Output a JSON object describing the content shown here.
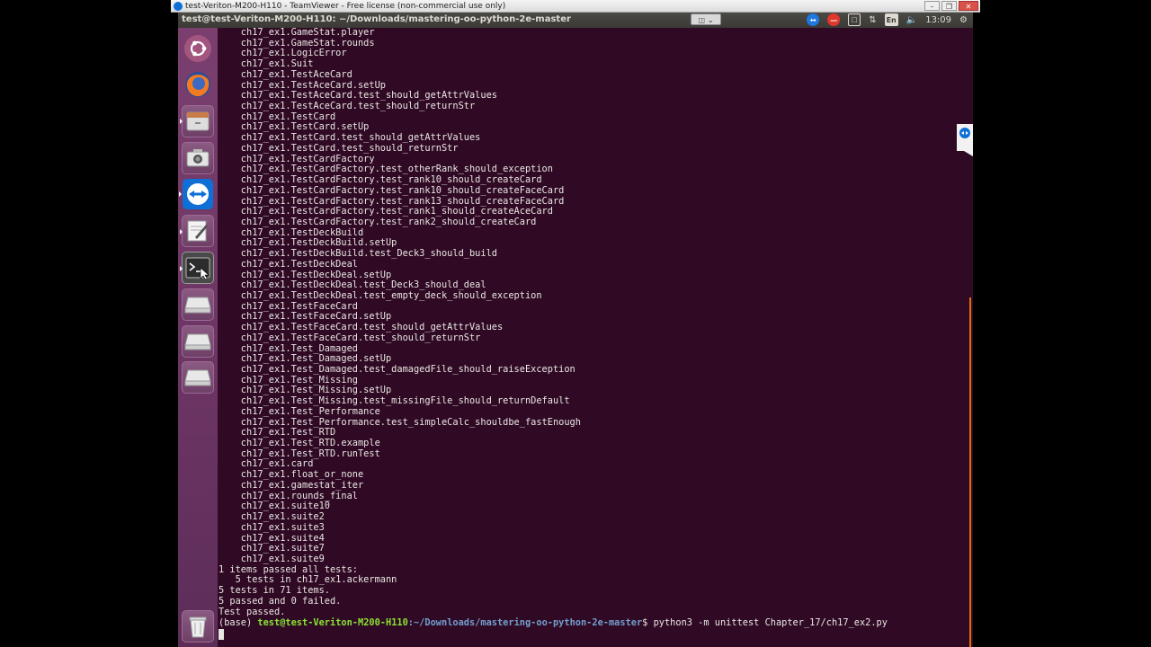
{
  "teamviewer": {
    "title": "test-Veriton-M200-H110 - TeamViewer - Free license (non-commercial use only)",
    "controls": [
      "minimize",
      "restore",
      "close"
    ]
  },
  "panel": {
    "window_title": "test@test-Veriton-M200-H110: ~/Downloads/mastering-oo-python-2e-master",
    "keyboard_layout": "En",
    "clock": "13:09"
  },
  "launcher": {
    "items": [
      {
        "name": "dash-icon"
      },
      {
        "name": "firefox-icon"
      },
      {
        "name": "files-icon"
      },
      {
        "name": "camera-icon"
      },
      {
        "name": "teamviewer-icon"
      },
      {
        "name": "text-editor-icon"
      },
      {
        "name": "terminal-icon"
      },
      {
        "name": "drive-icon"
      },
      {
        "name": "drive-icon"
      },
      {
        "name": "drive-icon"
      },
      {
        "name": "trash-icon"
      }
    ]
  },
  "terminal": {
    "output_lines": [
      "    ch17_ex1.GameStat.player",
      "    ch17_ex1.GameStat.rounds",
      "    ch17_ex1.LogicError",
      "    ch17_ex1.Suit",
      "    ch17_ex1.TestAceCard",
      "    ch17_ex1.TestAceCard.setUp",
      "    ch17_ex1.TestAceCard.test_should_getAttrValues",
      "    ch17_ex1.TestAceCard.test_should_returnStr",
      "    ch17_ex1.TestCard",
      "    ch17_ex1.TestCard.setUp",
      "    ch17_ex1.TestCard.test_should_getAttrValues",
      "    ch17_ex1.TestCard.test_should_returnStr",
      "    ch17_ex1.TestCardFactory",
      "    ch17_ex1.TestCardFactory.test_otherRank_should_exception",
      "    ch17_ex1.TestCardFactory.test_rank10_should_createCard",
      "    ch17_ex1.TestCardFactory.test_rank10_should_createFaceCard",
      "    ch17_ex1.TestCardFactory.test_rank13_should_createFaceCard",
      "    ch17_ex1.TestCardFactory.test_rank1_should_createAceCard",
      "    ch17_ex1.TestCardFactory.test_rank2_should_createCard",
      "    ch17_ex1.TestDeckBuild",
      "    ch17_ex1.TestDeckBuild.setUp",
      "    ch17_ex1.TestDeckBuild.test_Deck3_should_build",
      "    ch17_ex1.TestDeckDeal",
      "    ch17_ex1.TestDeckDeal.setUp",
      "    ch17_ex1.TestDeckDeal.test_Deck3_should_deal",
      "    ch17_ex1.TestDeckDeal.test_empty_deck_should_exception",
      "    ch17_ex1.TestFaceCard",
      "    ch17_ex1.TestFaceCard.setUp",
      "    ch17_ex1.TestFaceCard.test_should_getAttrValues",
      "    ch17_ex1.TestFaceCard.test_should_returnStr",
      "    ch17_ex1.Test_Damaged",
      "    ch17_ex1.Test_Damaged.setUp",
      "    ch17_ex1.Test_Damaged.test_damagedFile_should_raiseException",
      "    ch17_ex1.Test_Missing",
      "    ch17_ex1.Test_Missing.setUp",
      "    ch17_ex1.Test_Missing.test_missingFile_should_returnDefault",
      "    ch17_ex1.Test_Performance",
      "    ch17_ex1.Test_Performance.test_simpleCalc_shouldbe_fastEnough",
      "    ch17_ex1.Test_RTD",
      "    ch17_ex1.Test_RTD.example",
      "    ch17_ex1.Test_RTD.runTest",
      "    ch17_ex1.card",
      "    ch17_ex1.float_or_none",
      "    ch17_ex1.gamestat_iter",
      "    ch17_ex1.rounds_final",
      "    ch17_ex1.suite10",
      "    ch17_ex1.suite2",
      "    ch17_ex1.suite3",
      "    ch17_ex1.suite4",
      "    ch17_ex1.suite7",
      "    ch17_ex1.suite9",
      "1 items passed all tests:",
      "   5 tests in ch17_ex1.ackermann",
      "5 tests in 71 items.",
      "5 passed and 0 failed.",
      "Test passed."
    ],
    "prompt": {
      "env": "(base) ",
      "user_host": "test@test-Veriton-M200-H110",
      "path": ":~/Downloads/mastering-oo-python-2e-master",
      "symbol": "$ ",
      "command": "python3 -m unittest Chapter_17/ch17_ex2.py"
    }
  },
  "colors": {
    "terminal_bg": "#300a24",
    "launcher_bg": "#6b3463",
    "prompt_user": "#8ae234",
    "prompt_path": "#729fcf",
    "scrollbar": "#e06c0a"
  }
}
